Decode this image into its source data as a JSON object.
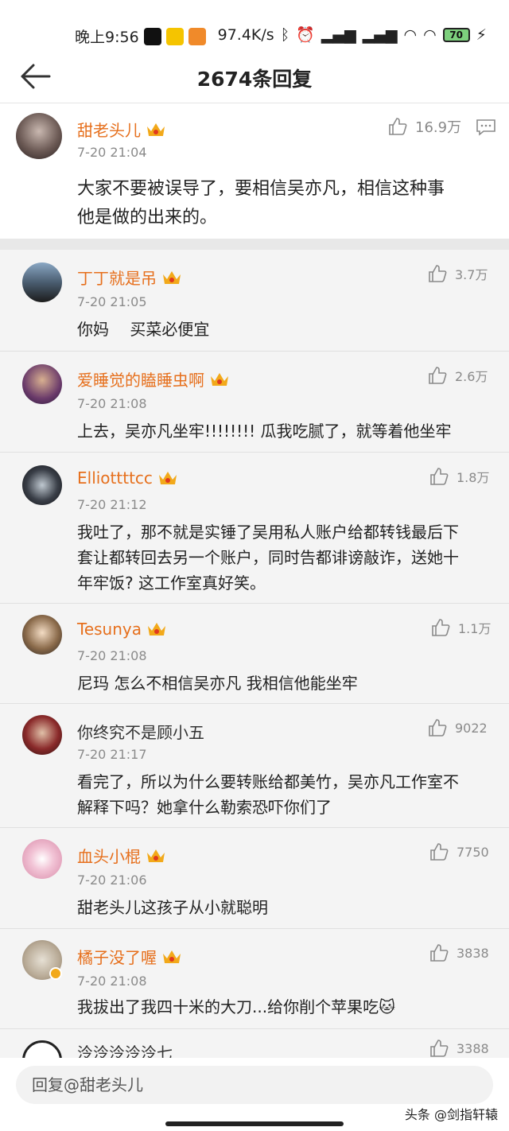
{
  "status": {
    "time": "晚上9:56",
    "speed": "97.4K/s",
    "battery": "70"
  },
  "header": {
    "title": "2674条回复"
  },
  "main_comment": {
    "user": "甜老头儿",
    "time": "7-20 21:04",
    "likes": "16.9万",
    "text_line1": "大家不要被误导了，要相信吴亦凡，相信这种事",
    "text_line2": "他是做的出来的。"
  },
  "replies": [
    {
      "user": "丁丁就是吊",
      "time": "7-20 21:05",
      "likes": "3.7万",
      "lines": [
        "你妈　  买菜必便宜"
      ],
      "vip": true
    },
    {
      "user": "爱睡觉的瞌睡虫啊",
      "time": "7-20 21:08",
      "likes": "2.6万",
      "lines": [
        "上去，吴亦凡坐牢!!!!!!!! 瓜我吃腻了，就等着他坐牢"
      ],
      "vip": true
    },
    {
      "user": "Elliottttcc",
      "time": "7-20 21:12",
      "likes": "1.8万",
      "lines": [
        "我吐了，那不就是实锤了吴用私人账户给都转钱最后下",
        "套让都转回去另一个账户，同时告都诽谤敲诈，送她十",
        "年牢饭? 这工作室真好笑。"
      ],
      "vip": true
    },
    {
      "user": "Tesunya",
      "time": "7-20 21:08",
      "likes": "1.1万",
      "lines": [
        "尼玛 怎么不相信吴亦凡 我相信他能坐牢"
      ],
      "vip": true
    },
    {
      "user": "你终究不是顾小五",
      "time": "7-20 21:17",
      "likes": "9022",
      "lines": [
        "看完了，所以为什么要转账给都美竹，吴亦凡工作室不",
        "解释下吗？她拿什么勒索恐吓你们了"
      ],
      "vip": false
    },
    {
      "user": "血头小棍",
      "time": "7-20 21:06",
      "likes": "7750",
      "lines": [
        "甜老头儿这孩子从小就聪明"
      ],
      "vip": true
    },
    {
      "user": "橘子没了喔",
      "time": "7-20 21:08",
      "likes": "3838",
      "lines": [
        "我拔出了我四十米的大刀...给你削个苹果吃🐱"
      ],
      "vip": true
    },
    {
      "user": "泠泠泠泠泠七",
      "time": "",
      "likes": "3388",
      "lines": [],
      "vip": false
    }
  ],
  "input": {
    "placeholder": "回复@甜老头儿"
  },
  "watermark": "头条 @剑指轩辕",
  "colors": {
    "username": "#e66f1c",
    "crown": "#f2a91a"
  }
}
